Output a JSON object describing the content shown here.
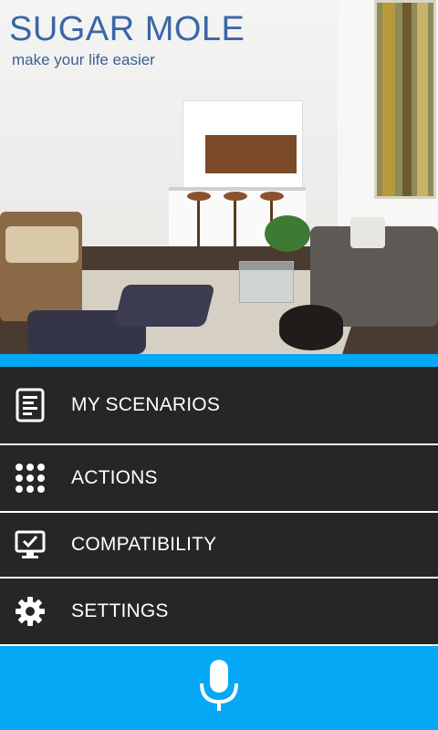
{
  "app": {
    "title": "SUGAR MOLE",
    "tagline": "make your life easier"
  },
  "colors": {
    "accent": "#05a8f4",
    "menu_bg": "#262626",
    "menu_text": "#ffffff",
    "brand": "#3a67a8"
  },
  "menu": {
    "items": [
      {
        "label": "MY SCENARIOS",
        "icon": "document-list-icon"
      },
      {
        "label": "ACTIONS",
        "icon": "grid-icon"
      },
      {
        "label": "COMPATIBILITY",
        "icon": "monitor-check-icon"
      },
      {
        "label": "SETTINGS",
        "icon": "gear-icon"
      }
    ]
  },
  "footer": {
    "icon": "microphone-icon"
  }
}
